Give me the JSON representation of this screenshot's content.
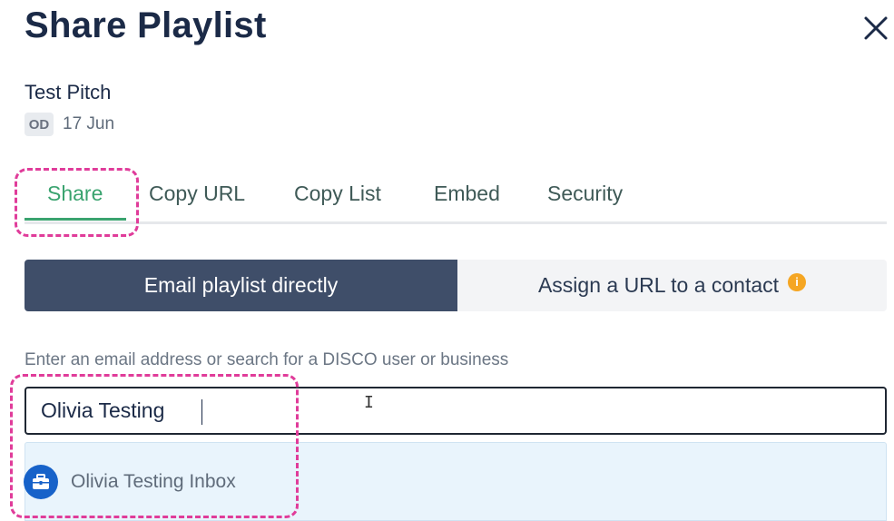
{
  "dialog": {
    "title": "Share Playlist"
  },
  "playlist": {
    "name": "Test Pitch",
    "owner_initials": "OD",
    "date": "17 Jun"
  },
  "tabs": [
    {
      "label": "Share",
      "active": true
    },
    {
      "label": "Copy URL",
      "active": false
    },
    {
      "label": "Copy List",
      "active": false
    },
    {
      "label": "Embed",
      "active": false
    },
    {
      "label": "Security",
      "active": false
    }
  ],
  "share_mode": {
    "options": [
      {
        "label": "Email playlist directly",
        "selected": true
      },
      {
        "label": "Assign a URL to a contact",
        "selected": false
      }
    ],
    "info_icon": "info-icon"
  },
  "recipient": {
    "label": "Enter an email address or search for a DISCO user or business",
    "value": "Olivia Testing"
  },
  "suggestions": [
    {
      "label": "Olivia Testing Inbox",
      "icon": "briefcase-icon"
    }
  ],
  "colors": {
    "accent_green": "#3aa36f",
    "segment_active": "#3f4e69",
    "highlight": "#e03c9a",
    "suggestion_bg": "#e9f4fc",
    "suggestion_icon": "#1762c9",
    "info": "#f5a623"
  }
}
